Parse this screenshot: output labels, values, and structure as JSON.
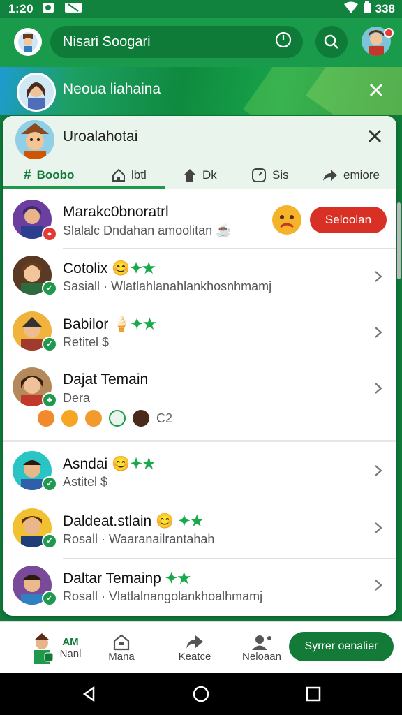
{
  "status": {
    "time": "1:20",
    "battery": "338"
  },
  "appbar": {
    "search_text": "Nisari Soogari"
  },
  "banner": {
    "title": "Neoua liahaina"
  },
  "sheet": {
    "title": "Uroalahotai",
    "tabs": [
      {
        "label": "Boobo",
        "icon": "hash-icon"
      },
      {
        "label": "lbtl",
        "icon": "home-icon"
      },
      {
        "label": "Dk",
        "icon": "house-up-icon"
      },
      {
        "label": "Sis",
        "icon": "clock-icon"
      },
      {
        "label": "emiore",
        "icon": "share-arrow-icon"
      }
    ]
  },
  "contacts": [
    {
      "name": "Marakc0bnoratrl",
      "sub": "Slalalc Dndahan amoolitan",
      "action": "Seloolan",
      "badge": "red"
    },
    {
      "name": "Cotolix",
      "sub": "Sasiall · Wlatlahlanahlankhosnhmamj",
      "badge": "green"
    },
    {
      "name": "Babilor",
      "sub": "Retitel $",
      "badge": "green"
    },
    {
      "name": "Dajat Temain",
      "sub": "Dera",
      "badge": "green",
      "reactions_more": "C2"
    },
    {
      "name": "Asndai",
      "sub": "Astitel $",
      "badge": "green"
    },
    {
      "name": "Daldeat.stlain",
      "sub": "Rosall · Waaranailrantahah",
      "badge": "green"
    },
    {
      "name": "Daltar Temainp",
      "sub": "Rosall · Vlatlalnangolankhoalhmamj",
      "badge": "green"
    }
  ],
  "bottom_nav": {
    "items": [
      {
        "label_top": "AM",
        "label": "Nanl"
      },
      {
        "label": "Mana"
      },
      {
        "label": "Keatce"
      },
      {
        "label": "Neloaan"
      }
    ],
    "cta": "Syrrer oenalier"
  },
  "colors": {
    "primary": "#1a9a4b",
    "dark": "#0e7c38",
    "danger": "#d93025"
  }
}
